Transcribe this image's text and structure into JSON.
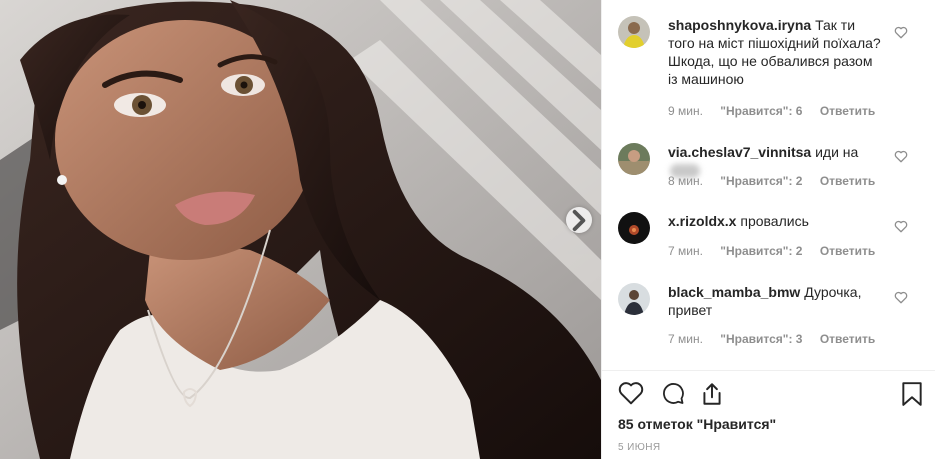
{
  "post": {
    "image_alt": "selfie photo",
    "next_icon": "chevron-right-icon"
  },
  "comments": [
    {
      "username": "shaposhnykova.iryna",
      "text": "Так ти того на міст пішохідний поїхала? Шкода, що не обвалився разом із машиною",
      "time": "9 мин.",
      "likes": "\"Нравится\": 6",
      "reply": "Ответить"
    },
    {
      "username": "via.cheslav7_vinnitsa",
      "text": "иди на",
      "time": "8 мин.",
      "likes": "\"Нравится\": 2",
      "reply": "Ответить"
    },
    {
      "username": "x.rizoldx.x",
      "text": "провались",
      "time": "7 мин.",
      "likes": "\"Нравится\": 2",
      "reply": "Ответить"
    },
    {
      "username": "black_mamba_bmw",
      "text": "Дурочка, привет",
      "time": "7 мин.",
      "likes": "\"Нравится\": 3",
      "reply": "Ответить"
    }
  ],
  "footer": {
    "likes_count": "85 отметок \"Нравится\"",
    "date": "5 июня"
  },
  "icons": {
    "like": "heart-icon",
    "comment": "comment-icon",
    "share": "share-icon",
    "save": "bookmark-icon"
  }
}
